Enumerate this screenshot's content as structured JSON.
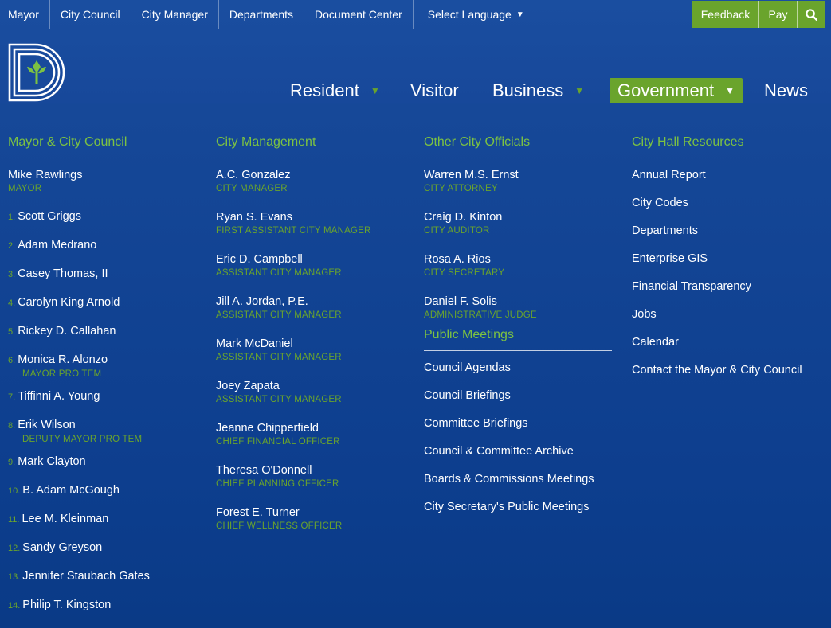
{
  "utility_nav": {
    "links": [
      "Mayor",
      "City Council",
      "City Manager",
      "Departments",
      "Document Center"
    ],
    "language": "Select Language",
    "feedback": "Feedback",
    "pay": "Pay"
  },
  "main_nav": {
    "resident": "Resident",
    "visitor": "Visitor",
    "business": "Business",
    "government": "Government",
    "news": "News"
  },
  "colors": {
    "accent": "#6aa42c",
    "heading": "#7cc242",
    "background": "#0b3d8c"
  },
  "council": {
    "heading": "Mayor & City Council",
    "mayor": {
      "name": "Mike Rawlings",
      "role": "MAYOR"
    },
    "members": [
      {
        "num": "1.",
        "name": "Scott Griggs",
        "role": ""
      },
      {
        "num": "2.",
        "name": "Adam Medrano",
        "role": ""
      },
      {
        "num": "3.",
        "name": "Casey Thomas, II",
        "role": ""
      },
      {
        "num": "4.",
        "name": "Carolyn King Arnold",
        "role": ""
      },
      {
        "num": "5.",
        "name": "Rickey D. Callahan",
        "role": ""
      },
      {
        "num": "6.",
        "name": "Monica R. Alonzo",
        "role": "MAYOR PRO TEM"
      },
      {
        "num": "7.",
        "name": "Tiffinni A. Young",
        "role": ""
      },
      {
        "num": "8.",
        "name": "Erik Wilson",
        "role": "DEPUTY MAYOR PRO TEM"
      },
      {
        "num": "9.",
        "name": "Mark Clayton",
        "role": ""
      },
      {
        "num": "10.",
        "name": "B. Adam McGough",
        "role": ""
      },
      {
        "num": "11.",
        "name": "Lee M. Kleinman",
        "role": ""
      },
      {
        "num": "12.",
        "name": "Sandy Greyson",
        "role": ""
      },
      {
        "num": "13.",
        "name": "Jennifer Staubach Gates",
        "role": ""
      },
      {
        "num": "14.",
        "name": "Philip T. Kingston",
        "role": ""
      }
    ]
  },
  "management": {
    "heading": "City Management",
    "people": [
      {
        "name": "A.C. Gonzalez",
        "role": "CITY MANAGER"
      },
      {
        "name": "Ryan S. Evans",
        "role": "FIRST ASSISTANT CITY MANAGER"
      },
      {
        "name": "Eric D. Campbell",
        "role": "ASSISTANT CITY MANAGER"
      },
      {
        "name": "Jill A. Jordan, P.E.",
        "role": "ASSISTANT CITY MANAGER"
      },
      {
        "name": "Mark McDaniel",
        "role": "ASSISTANT CITY MANAGER"
      },
      {
        "name": "Joey Zapata",
        "role": "ASSISTANT CITY MANAGER"
      },
      {
        "name": "Jeanne Chipperfield",
        "role": "CHIEF FINANCIAL OFFICER"
      },
      {
        "name": "Theresa O'Donnell",
        "role": "CHIEF PLANNING OFFICER"
      },
      {
        "name": "Forest E. Turner",
        "role": "CHIEF WELLNESS OFFICER"
      }
    ]
  },
  "officials": {
    "heading": "Other City Officials",
    "people": [
      {
        "name": "Warren M.S. Ernst",
        "role": "CITY ATTORNEY"
      },
      {
        "name": "Craig D. Kinton",
        "role": "CITY AUDITOR"
      },
      {
        "name": "Rosa A. Rios",
        "role": "CITY SECRETARY"
      },
      {
        "name": "Daniel F. Solis",
        "role": "ADMINISTRATIVE JUDGE"
      }
    ]
  },
  "meetings": {
    "heading": "Public Meetings",
    "links": [
      "Council Agendas",
      "Council Briefings",
      "Committee Briefings",
      "Council & Committee Archive",
      "Boards & Commissions Meetings",
      "City Secretary's Public Meetings"
    ]
  },
  "resources": {
    "heading": "City Hall Resources",
    "links": [
      "Annual Report",
      "City Codes",
      "Departments",
      "Enterprise GIS",
      "Financial Transparency",
      "Jobs",
      "Calendar",
      "Contact the Mayor & City Council"
    ]
  }
}
